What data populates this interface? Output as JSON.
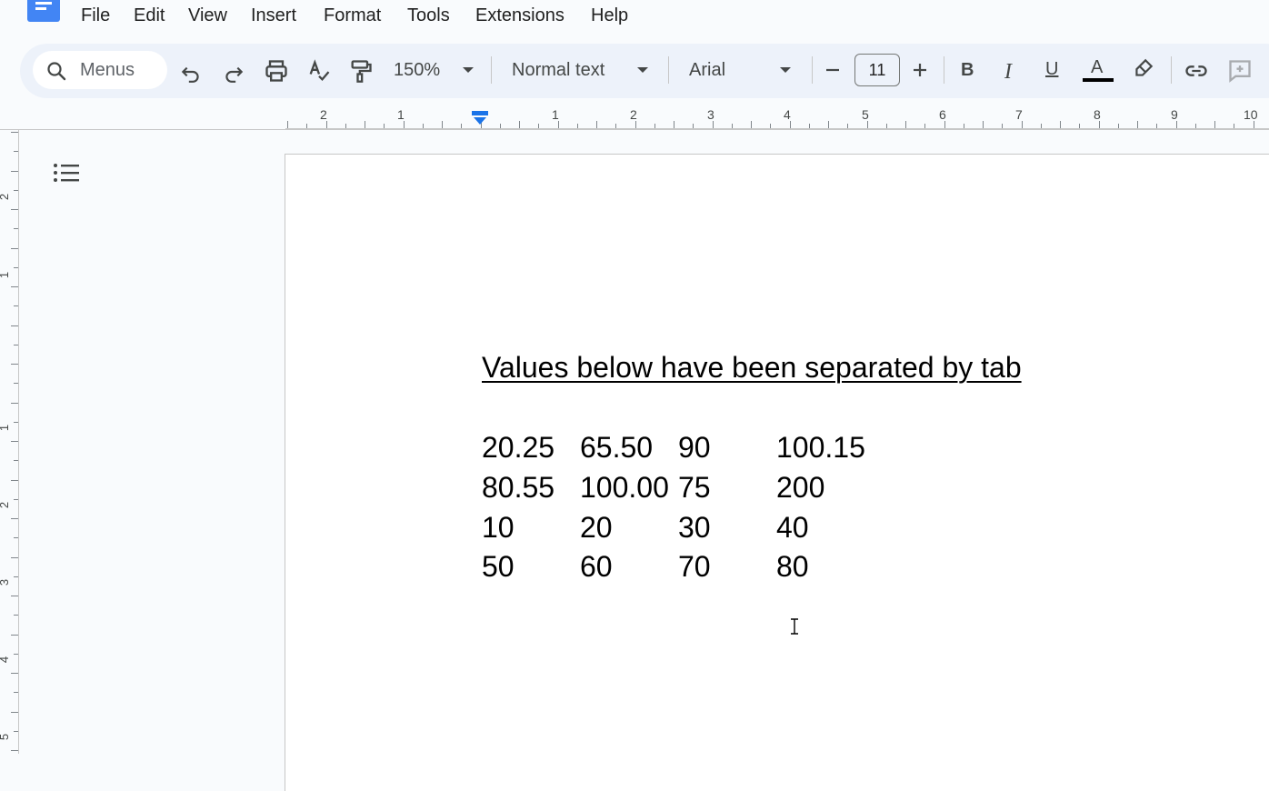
{
  "menubar": {
    "items": [
      "File",
      "Edit",
      "View",
      "Insert",
      "Format",
      "Tools",
      "Extensions",
      "Help"
    ]
  },
  "toolbar": {
    "search_label": "Menus",
    "zoom": "150%",
    "style": "Normal text",
    "font": "Arial",
    "font_size": "11",
    "bold": "B",
    "italic": "I",
    "underline": "U",
    "text_color_letter": "A"
  },
  "ruler": {
    "h_numbers": [
      "2",
      "1",
      "1",
      "2",
      "3",
      "4",
      "5",
      "6",
      "7",
      "8",
      "9",
      "10"
    ],
    "v_numbers": [
      "2",
      "1",
      "1",
      "2",
      "3",
      "4",
      "5"
    ]
  },
  "document": {
    "heading": "Values below have been separated by tab",
    "rows": [
      [
        "20.25",
        "65.50",
        "90",
        "100.15"
      ],
      [
        "80.55",
        "100.00",
        "75",
        "200"
      ],
      [
        "10",
        "20",
        "30",
        "40"
      ],
      [
        "50",
        "60",
        "70",
        "80"
      ]
    ]
  },
  "colors": {
    "accent": "#1a73e8",
    "toolbar_bg": "#edf2fa",
    "page_bg": "#f9fbfd",
    "logo": "#4285f4"
  }
}
